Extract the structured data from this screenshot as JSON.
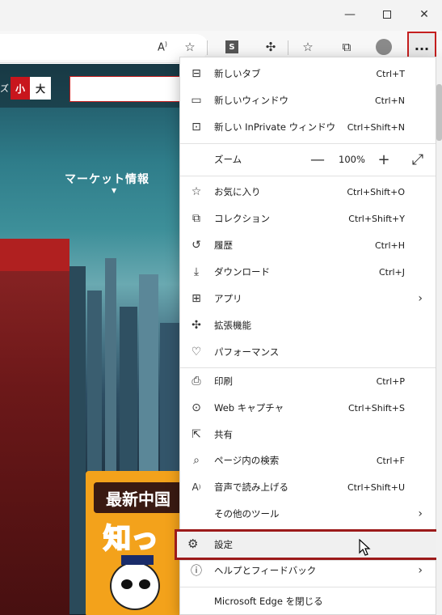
{
  "window": {
    "minimize_icon": "minimize-icon",
    "maximize_icon": "maximize-icon",
    "close_icon": "close-icon"
  },
  "toolbar": {
    "read_aloud_icon": "read-aloud-icon",
    "add_favorite_icon": "add-favorite-icon",
    "extension_s_label": "S",
    "menu_label": "..."
  },
  "webpage": {
    "fontsize_label": "ズ",
    "fontsize_small": "小",
    "fontsize_large": "大",
    "market_label": "マーケット情報",
    "banner_line1": "最新中国",
    "banner_line2": "知っ"
  },
  "menu": {
    "items": [
      {
        "label": "新しいタブ",
        "shortcut": "Ctrl+T",
        "icon": "new-tab-icon"
      },
      {
        "label": "新しいウィンドウ",
        "shortcut": "Ctrl+N",
        "icon": "new-window-icon"
      },
      {
        "label": "新しい InPrivate ウィンドウ",
        "shortcut": "Ctrl+Shift+N",
        "icon": "inprivate-icon"
      },
      {
        "label": "お気に入り",
        "shortcut": "Ctrl+Shift+O",
        "icon": "favorites-icon"
      },
      {
        "label": "コレクション",
        "shortcut": "Ctrl+Shift+Y",
        "icon": "collections-icon"
      },
      {
        "label": "履歴",
        "shortcut": "Ctrl+H",
        "icon": "history-icon"
      },
      {
        "label": "ダウンロード",
        "shortcut": "Ctrl+J",
        "icon": "download-icon"
      },
      {
        "label": "アプリ",
        "shortcut": "",
        "icon": "apps-icon"
      },
      {
        "label": "拡張機能",
        "shortcut": "",
        "icon": "extensions-icon"
      },
      {
        "label": "パフォーマンス",
        "shortcut": "",
        "icon": "performance-icon"
      },
      {
        "label": "印刷",
        "shortcut": "Ctrl+P",
        "icon": "print-icon"
      },
      {
        "label": "Web キャプチャ",
        "shortcut": "Ctrl+Shift+S",
        "icon": "web-capture-icon"
      },
      {
        "label": "共有",
        "shortcut": "",
        "icon": "share-icon"
      },
      {
        "label": "ページ内の検索",
        "shortcut": "Ctrl+F",
        "icon": "find-icon"
      },
      {
        "label": "音声で読み上げる",
        "shortcut": "Ctrl+Shift+U",
        "icon": "read-aloud-icon"
      },
      {
        "label": "その他のツール",
        "shortcut": "",
        "icon": ""
      },
      {
        "label": "設定",
        "shortcut": "",
        "icon": "settings-icon"
      },
      {
        "label": "ヘルプとフィードバック",
        "shortcut": "",
        "icon": "help-icon"
      },
      {
        "label": "Microsoft Edge を閉じる",
        "shortcut": "",
        "icon": ""
      }
    ],
    "zoom": {
      "label": "ズーム",
      "minus": "—",
      "value": "100%",
      "plus": "+"
    }
  },
  "colors": {
    "highlight_border": "#9c1a1a",
    "menu_button_border": "#c41e1e",
    "brand_red": "#c8161d"
  }
}
